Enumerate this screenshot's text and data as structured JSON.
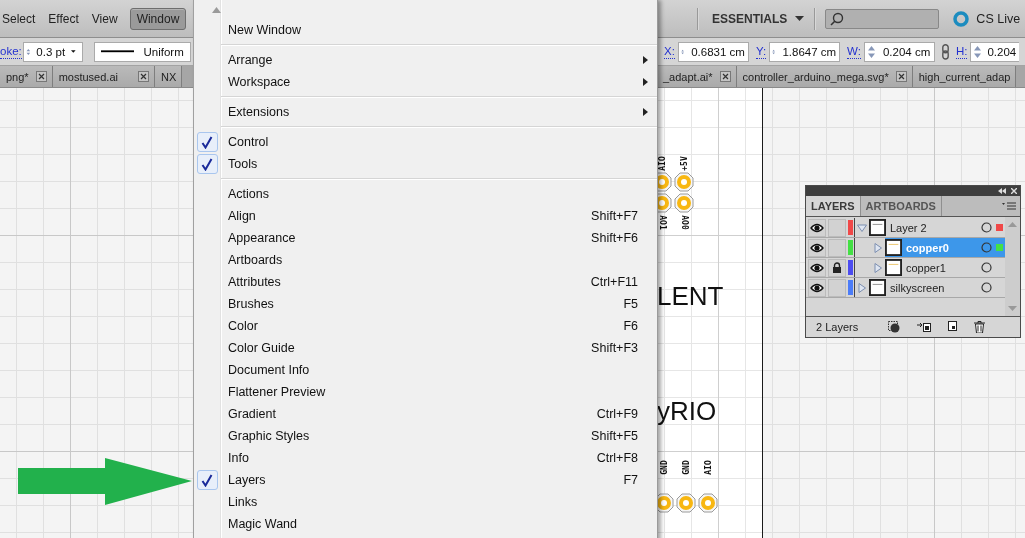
{
  "menubar": {
    "items": [
      {
        "label": "Select",
        "selected": false
      },
      {
        "label": "Effect",
        "selected": false
      },
      {
        "label": "View",
        "selected": false
      },
      {
        "label": "Window",
        "selected": true
      }
    ],
    "workspace": "ESSENTIALS",
    "cs_live": "CS Live"
  },
  "control_bar": {
    "stroke_label": "oke:",
    "stroke_weight": "0.3 pt",
    "stroke_profile": "Uniform",
    "fields": [
      {
        "label": "X:",
        "value": "0.6831 cm"
      },
      {
        "label": "Y:",
        "value": "1.8647 cm"
      },
      {
        "label": "W:",
        "value": "0.204 cm"
      },
      {
        "label": "H:",
        "value": "0.204"
      }
    ]
  },
  "document_tabs": {
    "left": [
      {
        "label": "png*",
        "closable": true
      },
      {
        "label": "mostused.ai",
        "closable": true
      },
      {
        "label": "NX",
        "closable": false
      }
    ],
    "right": [
      {
        "label": "_adapt.ai*",
        "closable": true
      },
      {
        "label": "controller_arduino_mega.svg*",
        "closable": true
      },
      {
        "label": "high_current_adap",
        "closable": false
      }
    ]
  },
  "window_menu": {
    "items": [
      {
        "kind": "item",
        "label": "New Window",
        "checked": false,
        "submenu": false
      },
      {
        "kind": "separator"
      },
      {
        "kind": "item",
        "label": "Arrange",
        "checked": false,
        "submenu": true
      },
      {
        "kind": "item",
        "label": "Workspace",
        "checked": false,
        "submenu": true
      },
      {
        "kind": "separator"
      },
      {
        "kind": "item",
        "label": "Extensions",
        "checked": false,
        "submenu": true
      },
      {
        "kind": "separator"
      },
      {
        "kind": "item",
        "label": "Control",
        "checked": true,
        "submenu": false
      },
      {
        "kind": "item",
        "label": "Tools",
        "checked": true,
        "submenu": false
      },
      {
        "kind": "separator"
      },
      {
        "kind": "item",
        "label": "Actions",
        "checked": false,
        "submenu": false
      },
      {
        "kind": "item",
        "label": "Align",
        "shortcut": "Shift+F7",
        "checked": false,
        "submenu": false
      },
      {
        "kind": "item",
        "label": "Appearance",
        "shortcut": "Shift+F6",
        "checked": false,
        "submenu": false
      },
      {
        "kind": "item",
        "label": "Artboards",
        "checked": false,
        "submenu": false
      },
      {
        "kind": "item",
        "label": "Attributes",
        "shortcut": "Ctrl+F11",
        "checked": false,
        "submenu": false
      },
      {
        "kind": "item",
        "label": "Brushes",
        "shortcut": "F5",
        "checked": false,
        "submenu": false
      },
      {
        "kind": "item",
        "label": "Color",
        "shortcut": "F6",
        "checked": false,
        "submenu": false
      },
      {
        "kind": "item",
        "label": "Color Guide",
        "shortcut": "Shift+F3",
        "checked": false,
        "submenu": false
      },
      {
        "kind": "item",
        "label": "Document Info",
        "checked": false,
        "submenu": false
      },
      {
        "kind": "item",
        "label": "Flattener Preview",
        "checked": false,
        "submenu": false
      },
      {
        "kind": "item",
        "label": "Gradient",
        "shortcut": "Ctrl+F9",
        "checked": false,
        "submenu": false
      },
      {
        "kind": "item",
        "label": "Graphic Styles",
        "shortcut": "Shift+F5",
        "checked": false,
        "submenu": false
      },
      {
        "kind": "item",
        "label": "Info",
        "shortcut": "Ctrl+F8",
        "checked": false,
        "submenu": false
      },
      {
        "kind": "item",
        "label": "Layers",
        "shortcut": "F7",
        "checked": true,
        "submenu": false
      },
      {
        "kind": "item",
        "label": "Links",
        "checked": false,
        "submenu": false
      },
      {
        "kind": "item",
        "label": "Magic Wand",
        "checked": false,
        "submenu": false
      }
    ]
  },
  "artboard": {
    "header_top": [
      {
        "label_top": "AIO",
        "label_bottom": "AO1"
      },
      {
        "label_top": "+5V",
        "label_bottom": "AO0"
      }
    ],
    "texts": [
      "LENT",
      "yRIO"
    ],
    "header_bottom": [
      {
        "label": "GND"
      },
      {
        "label": "GND"
      },
      {
        "label": "AIO"
      }
    ]
  },
  "layers_panel": {
    "tabs": [
      {
        "label": "LAYERS",
        "selected": true
      },
      {
        "label": "ARTBOARDS",
        "selected": false
      }
    ],
    "layers": [
      {
        "name": "Layer 2",
        "color": "#f04848",
        "visible": true,
        "locked": false,
        "expanded": true,
        "selected": false,
        "has_selected_art": true,
        "children": [
          {
            "name": "copper0",
            "color": "#44e044",
            "visible": true,
            "locked": false,
            "expanded": false,
            "selected": true,
            "has_selected_art": true
          },
          {
            "name": "copper1",
            "color": "#4c4cf0",
            "visible": true,
            "locked": true,
            "expanded": false,
            "selected": false,
            "has_selected_art": false
          }
        ]
      },
      {
        "name": "silkyscreen",
        "color": "#4c7cf8",
        "visible": true,
        "locked": false,
        "expanded": false,
        "selected": false,
        "has_selected_art": false
      }
    ],
    "footer": "2 Layers"
  }
}
